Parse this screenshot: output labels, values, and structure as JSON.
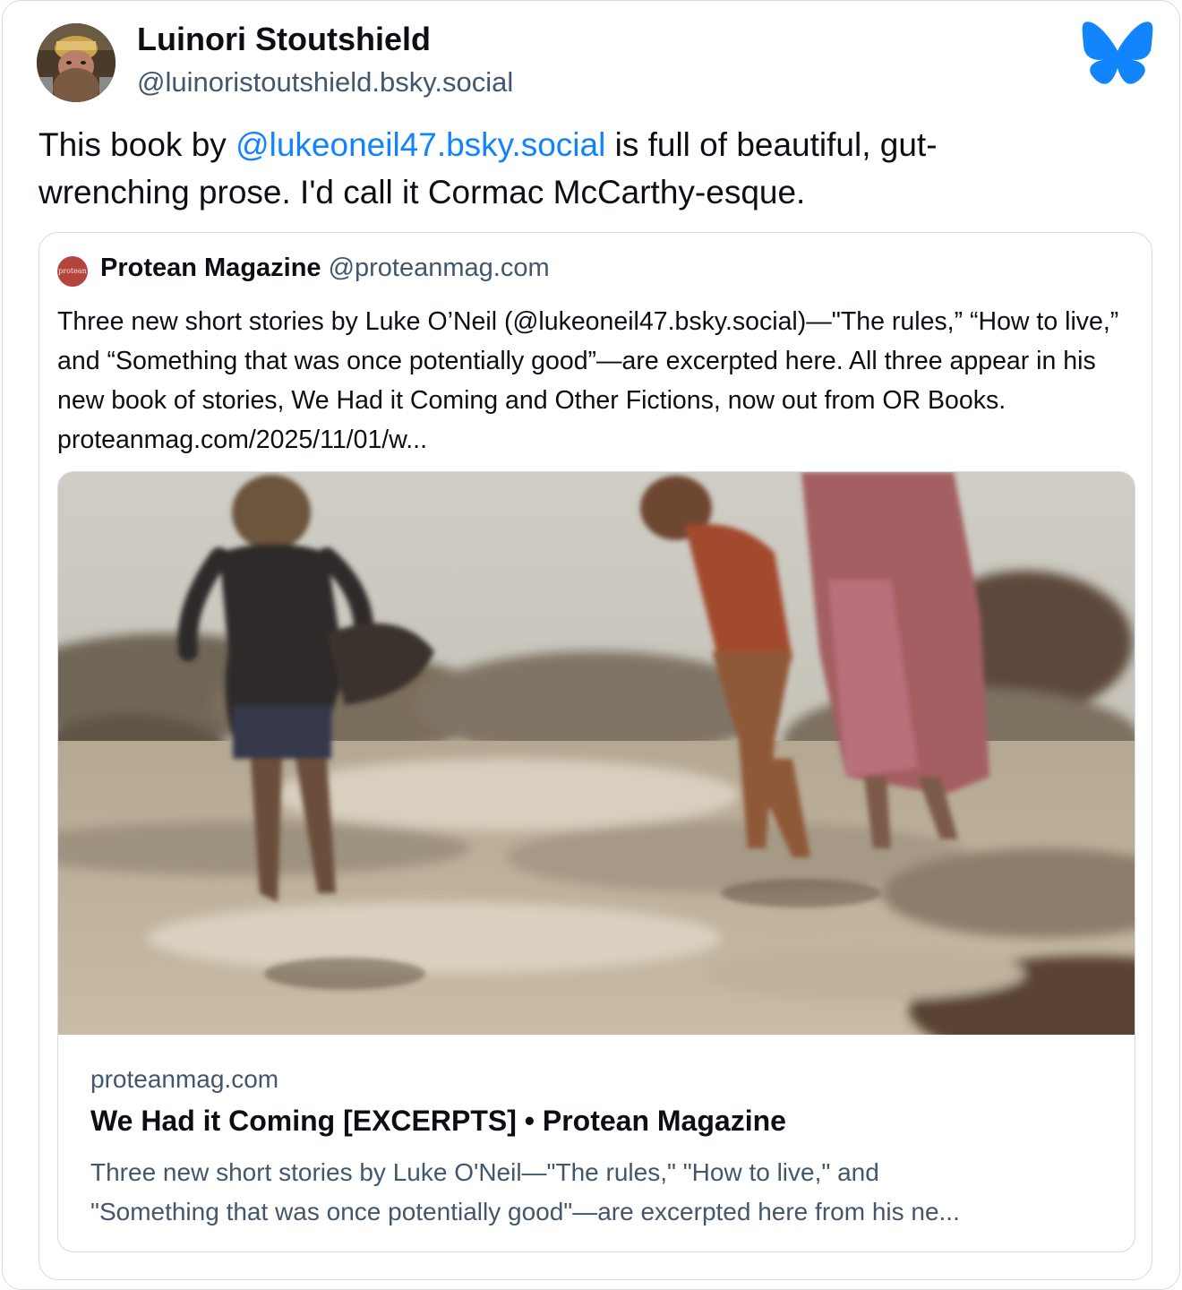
{
  "post": {
    "author_name": "Luinori Stoutshield",
    "author_handle": "@luinoristoutshield.bsky.social",
    "avatar_icon": "bearded-warrior-avatar",
    "brand_icon": "bluesky-butterfly-icon",
    "text_before": "This book by ",
    "mention": "@lukeoneil47.bsky.social",
    "text_after": " is full of beautiful, gut-wrenching prose. I'd call it Cormac McCarthy-esque."
  },
  "quote": {
    "author_name": "Protean Magazine",
    "author_handle": "@proteanmag.com",
    "avatar_text": "protean",
    "text": "Three new short stories by Luke O’Neil (@lukeoneil47.bsky.social)—\"The rules,” “How to live,” and “Something that was once potentially good”—are excerpted here. All three appear in his new book of stories, We Had it Coming and Other Fictions, now out from OR Books. proteanmag.com/2025/11/01/w...",
    "embed": {
      "image_alt": "photo-children-running-on-rocky-beach",
      "domain": "proteanmag.com",
      "title": "We Had it Coming [EXCERPTS] • Protean Magazine",
      "description_line1": "Three new short stories by Luke O'Neil—\"The rules,\" \"How to live,\" and",
      "description_line2": "\"Something that was once potentially good\"—are excerpted here from his ne..."
    }
  },
  "colors": {
    "text": "#0b0f14",
    "muted": "#42576c",
    "link": "#1083fe",
    "border": "#d4dbe2",
    "bluesky": "#1185fe"
  }
}
